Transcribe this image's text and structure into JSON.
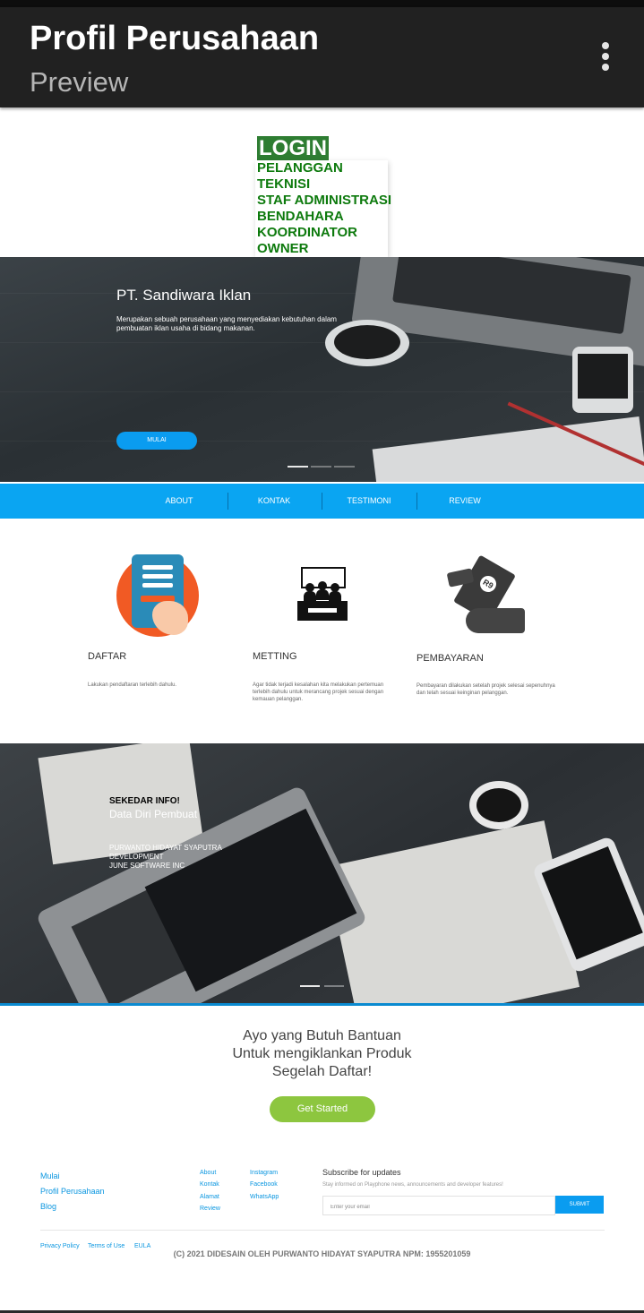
{
  "app_bar": {
    "title": "Profil Perusahaan",
    "subtitle": "Preview",
    "menu_icon": "more-vert-icon"
  },
  "login_menu": {
    "header": "LOGIN",
    "items": [
      "PELANGGAN",
      "TEKNISI",
      "STAF ADMINISTRASI",
      "BENDAHARA",
      "KOORDINATOR",
      "OWNER"
    ]
  },
  "hero": {
    "title": "PT. Sandiwara Iklan",
    "description": "Merupakan sebuah perusahaan yang menyediakan kebutuhan dalam pembuatan iklan usaha di bidang makanan.",
    "button": "MULAI",
    "slides": 3,
    "active_slide": 1
  },
  "nav": [
    "ABOUT",
    "KONTAK",
    "TESTIMONI",
    "REVIEW"
  ],
  "services": [
    {
      "icon": "tablet-register-icon",
      "title": "DAFTAR",
      "desc": "Lakukan pendaftaran terlebih dahulu."
    },
    {
      "icon": "meeting-icon",
      "title": "METTING",
      "desc": "Agar tidak terjadi kesalahan kita melakukan pertemuan terlebih dahulu untuk merancang projek sesuai dengan kemauan pelanggan."
    },
    {
      "icon": "payment-icon",
      "title": "PEMBAYARAN",
      "desc": "Pembayaran dilakukan setelah projek selesai sepenuhnya dan telah sesuai keinginan pelanggan."
    }
  ],
  "info": {
    "kicker": "SEKEDAR INFO!",
    "title": "Data Diri Pembuat",
    "lines": [
      "PURWANTO HIDAYAT SYAPUTRA",
      "DEVELOPMENT",
      "JUNE SOFTWARE INC"
    ],
    "slides": 2,
    "active_slide": 1
  },
  "cta": {
    "lines": [
      "Ayo yang Butuh Bantuan",
      "Untuk mengiklankan Produk",
      "Segelah Daftar!"
    ],
    "button": "Get Started"
  },
  "footer": {
    "col1": [
      "Mulai",
      "Profil Perusahaan",
      "Blog"
    ],
    "col2": [
      "About",
      "Kontak",
      "Alamat",
      "Review"
    ],
    "col3": [
      "Instagram",
      "Facebook",
      "WhatsApp"
    ],
    "subscribe_title": "Subscribe for updates",
    "subscribe_note": "Stay informed on Playphone news, announcements and developer features!",
    "email_placeholder": "Enter your email",
    "submit": "SUBMIT",
    "legal": [
      "Privacy Policy",
      "Terms of Use",
      "EULA"
    ],
    "copyright": "(C) 2021 DIDESAIN OLEH PURWANTO HIDAYAT SYAPUTRA NPM: 1955201059"
  },
  "colors": {
    "app_bar": "#212121",
    "login_green": "#2e7d32",
    "accent_blue": "#0aa5f2",
    "cta_green": "#8dc63f"
  }
}
